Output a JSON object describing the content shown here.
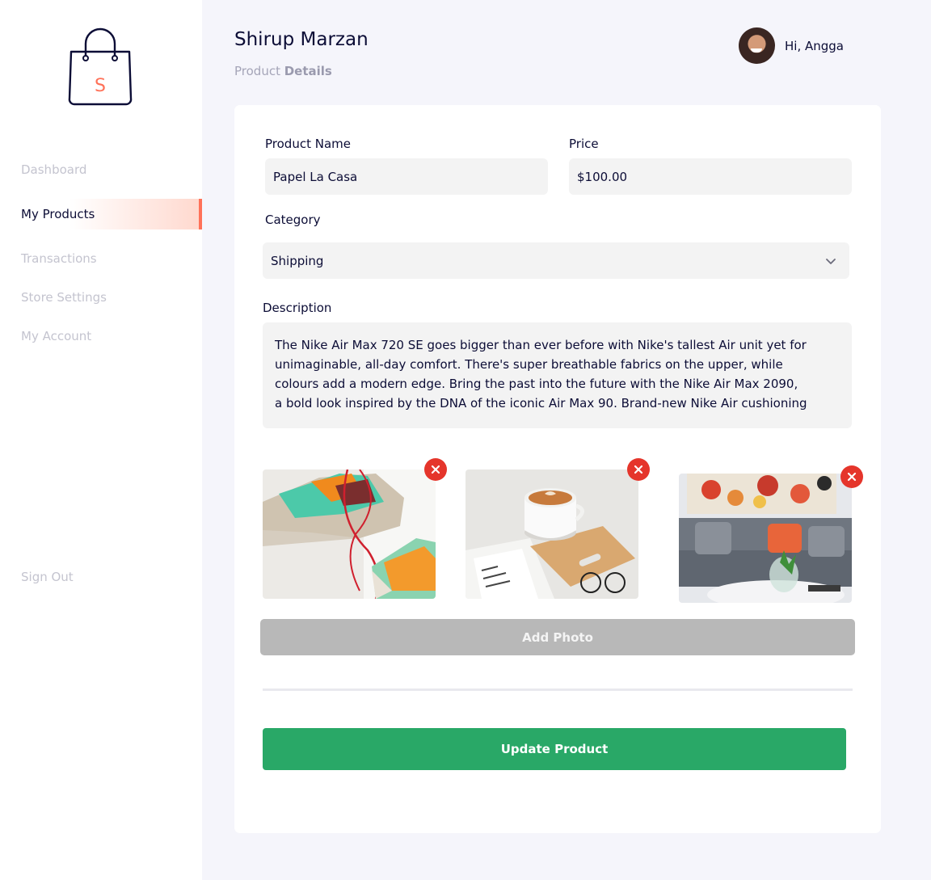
{
  "sidebar": {
    "logo_letter": "S",
    "items": [
      {
        "label": "Dashboard",
        "active": false
      },
      {
        "label": "My Products",
        "active": true
      },
      {
        "label": "Transactions",
        "active": false
      },
      {
        "label": "Store Settings",
        "active": false
      },
      {
        "label": "My Account",
        "active": false
      }
    ],
    "sign_out": "Sign Out"
  },
  "header": {
    "title": "Shirup Marzan",
    "breadcrumb_prefix": "Product",
    "breadcrumb_current": "Details",
    "greeting": "Hi, Angga"
  },
  "form": {
    "product_name_label": "Product Name",
    "product_name_value": "Papel La Casa",
    "price_label": "Price",
    "price_value": "$100.00",
    "category_label": "Category",
    "category_value": "Shipping",
    "description_label": "Description",
    "description_lines": [
      "The Nike Air Max 720 SE goes bigger than ever before with Nike's tallest Air unit yet for",
      "unimaginable, all-day comfort. There's super breathable fabrics on the upper, while",
      "colours add a modern edge. Bring the past into the future with the Nike Air Max 2090,",
      "a bold look inspired by the DNA of the iconic Air Max 90. Brand-new Nike Air cushioning"
    ],
    "add_photo_label": "Add Photo",
    "update_label": "Update Product"
  },
  "photos": [
    {
      "subject": "sneakers"
    },
    {
      "subject": "latte-cup"
    },
    {
      "subject": "sofa-living-room"
    }
  ],
  "colors": {
    "accent": "#ff7158",
    "primary_text": "#0c0d36",
    "update_button": "#29a867",
    "remove_button": "#e5352b",
    "add_photo_button": "#b8b8b8"
  }
}
